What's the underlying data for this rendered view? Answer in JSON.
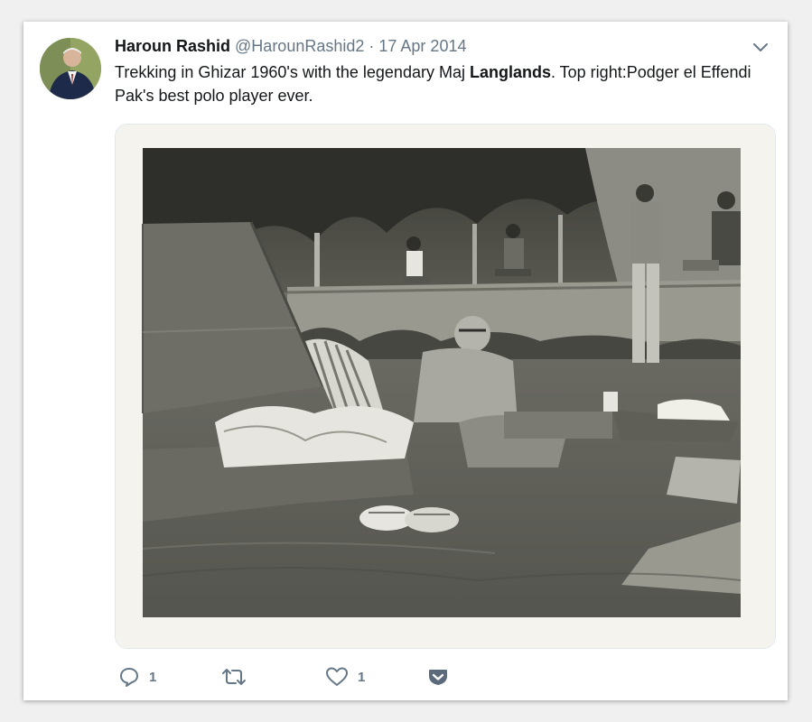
{
  "tweet": {
    "author_name": "Haroun Rashid",
    "handle": "@HarounRashid2",
    "separator": " · ",
    "date": "17 Apr 2014",
    "text_part1": "Trekking in Ghizar 1960's with the legendary Maj ",
    "text_bold": "Langlands",
    "text_part2": ". Top right:Podger el Effendi Pak's best polo player ever.",
    "avatar_icon": "user-avatar",
    "menu_icon": "chevron-down-icon"
  },
  "actions": {
    "reply_count": "1",
    "retweet_count": "",
    "like_count": "1",
    "reply_icon": "reply-icon",
    "retweet_icon": "retweet-icon",
    "like_icon": "heart-icon",
    "pocket_icon": "pocket-icon"
  },
  "colors": {
    "secondary_text": "#657786",
    "primary_text": "#14171a",
    "pocket": "#5b6b7b"
  }
}
